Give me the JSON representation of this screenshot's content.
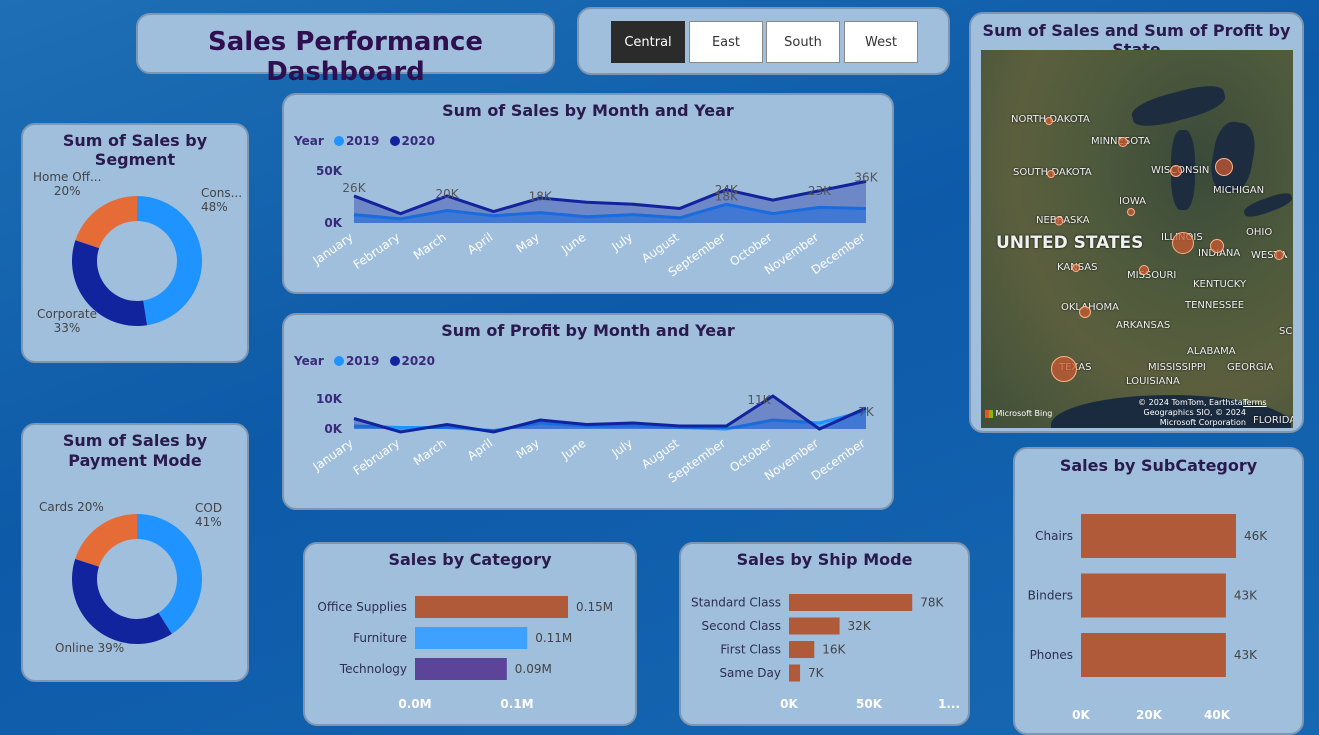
{
  "header": {
    "title": "Sales Performance Dashboard"
  },
  "region_slicer": {
    "options": [
      "Central",
      "East",
      "South",
      "West"
    ],
    "selected": "Central"
  },
  "segment_chart": {
    "title": "Sum of Sales by Segment",
    "labels": [
      {
        "name": "Home Off...",
        "pct": "20%"
      },
      {
        "name": "Cons...",
        "pct": "48%"
      },
      {
        "name": "Corporate",
        "pct": "33%"
      }
    ]
  },
  "payment_chart": {
    "title": "Sum of Sales by Payment Mode",
    "labels": [
      {
        "text": "Cards 20%"
      },
      {
        "name": "COD",
        "pct": "41%"
      },
      {
        "text": "Online 39%"
      }
    ]
  },
  "sales_month_chart": {
    "title": "Sum of Sales by Month and Year",
    "legend_title": "Year",
    "legend": [
      "2019",
      "2020"
    ],
    "y_ticks": [
      "50K",
      "0K"
    ],
    "annotations": [
      "26K",
      "20K",
      "18K",
      "24K",
      "18K",
      "23K",
      "36K"
    ]
  },
  "profit_month_chart": {
    "title": "Sum of Profit by Month and Year",
    "legend_title": "Year",
    "legend": [
      "2019",
      "2020"
    ],
    "y_ticks": [
      "10K",
      "0K"
    ],
    "annotations": [
      "11K",
      "7K"
    ]
  },
  "map_chart": {
    "title": "Sum of Sales and Sum of Profit by State",
    "country_label": "UNITED STATES",
    "states": [
      "NORTH DAKOTA",
      "MINNESOTA",
      "SOUTH DAKOTA",
      "WISCONSIN",
      "MICHIGAN",
      "IOWA",
      "NEBRASKA",
      "ILLINOIS",
      "INDIANA",
      "OHIO",
      "KANSAS",
      "MISSOURI",
      "KENTUCKY",
      "WEST VIRGINIA",
      "OKLAHOMA",
      "TENNESSEE",
      "ARKANSAS",
      "ALABAMA",
      "GEORGIA",
      "MISSISSIPPI",
      "TEXAS",
      "LOUISIANA",
      "FLORIDA",
      "SC"
    ],
    "attribution": "© 2024 TomTom, Earthstar Geographics SIO, © 2024 Microsoft Corporation",
    "terms": "Terms",
    "bing": "Microsoft Bing"
  },
  "category_chart": {
    "title": "Sales by Category",
    "categories": [
      "Office Supplies",
      "Furniture",
      "Technology"
    ],
    "value_labels": [
      "0.15M",
      "0.11M",
      "0.09M"
    ],
    "x_ticks": [
      "0.0M",
      "0.1M"
    ]
  },
  "shipmode_chart": {
    "title": "Sales by Ship Mode",
    "categories": [
      "Standard Class",
      "Second Class",
      "First Class",
      "Same Day"
    ],
    "value_labels": [
      "78K",
      "32K",
      "16K",
      "7K"
    ],
    "x_ticks": [
      "0K",
      "50K",
      "1..."
    ]
  },
  "subcategory_chart": {
    "title": "Sales by SubCategory",
    "categories": [
      "Chairs",
      "Binders",
      "Phones"
    ],
    "value_labels": [
      "46K",
      "43K",
      "43K"
    ],
    "x_ticks": [
      "0K",
      "20K",
      "40K"
    ]
  },
  "chart_data": [
    {
      "type": "pie",
      "title": "Sum of Sales by Segment",
      "categories": [
        "Consumer",
        "Corporate",
        "Home Office"
      ],
      "values": [
        48,
        33,
        20
      ],
      "colors": [
        "#1f93ff",
        "#12239e",
        "#e66c37"
      ]
    },
    {
      "type": "pie",
      "title": "Sum of Sales by Payment Mode",
      "categories": [
        "COD",
        "Online",
        "Cards"
      ],
      "values": [
        41,
        39,
        20
      ],
      "colors": [
        "#1f93ff",
        "#12239e",
        "#e66c37"
      ]
    },
    {
      "type": "area",
      "title": "Sum of Sales by Month and Year",
      "x": [
        "January",
        "February",
        "March",
        "April",
        "May",
        "June",
        "July",
        "August",
        "September",
        "October",
        "November",
        "December"
      ],
      "series": [
        {
          "name": "2019",
          "values": [
            8,
            4,
            12,
            7,
            10,
            6,
            8,
            5,
            18,
            9,
            15,
            14
          ]
        },
        {
          "name": "2020",
          "values": [
            26,
            9,
            26,
            11,
            24,
            20,
            18,
            14,
            32,
            22,
            31,
            40
          ]
        }
      ],
      "ylim": [
        0,
        50
      ],
      "colors": [
        "#1f93ff",
        "#12239e"
      ]
    },
    {
      "type": "area",
      "title": "Sum of Profit by Month and Year",
      "x": [
        "January",
        "February",
        "March",
        "April",
        "May",
        "June",
        "July",
        "August",
        "September",
        "October",
        "November",
        "December"
      ],
      "series": [
        {
          "name": "2019",
          "values": [
            1,
            0.5,
            0.5,
            -0.5,
            2,
            1,
            1,
            0.5,
            0,
            3,
            2,
            6
          ]
        },
        {
          "name": "2020",
          "values": [
            3.5,
            -1,
            1.5,
            -1,
            3,
            1.5,
            2,
            1,
            1,
            11,
            0,
            7
          ]
        }
      ],
      "ylim": [
        -2,
        12
      ],
      "colors": [
        "#1f93ff",
        "#12239e"
      ]
    },
    {
      "type": "bar",
      "title": "Sales by Category",
      "categories": [
        "Office Supplies",
        "Furniture",
        "Technology"
      ],
      "values": [
        0.15,
        0.11,
        0.09
      ],
      "xlim": [
        0,
        0.15
      ],
      "colors": [
        "#b05a3a",
        "#3ea0ff",
        "#5b449a"
      ]
    },
    {
      "type": "bar",
      "title": "Sales by Ship Mode",
      "categories": [
        "Standard Class",
        "Second Class",
        "First Class",
        "Same Day"
      ],
      "values": [
        78,
        32,
        16,
        7
      ],
      "xlim": [
        0,
        100
      ],
      "colors": [
        "#b05a3a"
      ]
    },
    {
      "type": "bar",
      "title": "Sales by SubCategory",
      "categories": [
        "Chairs",
        "Binders",
        "Phones"
      ],
      "values": [
        46,
        43,
        43
      ],
      "xlim": [
        0,
        46
      ],
      "colors": [
        "#b05a3a"
      ]
    }
  ]
}
